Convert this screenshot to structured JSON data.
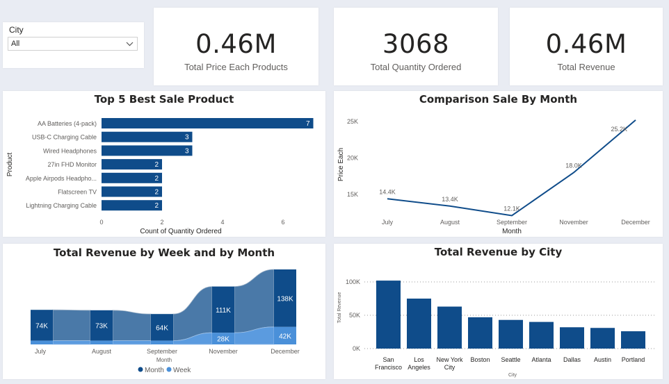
{
  "slicer": {
    "label": "City",
    "value": "All"
  },
  "kpis": [
    {
      "value": "0.46M",
      "label": "Total Price Each Products"
    },
    {
      "value": "3068",
      "label": "Total Quantity Ordered"
    },
    {
      "value": "0.46M",
      "label": "Total Revenue"
    }
  ],
  "titles": {
    "top5": "Top 5 Best Sale Product",
    "month": "Comparison Sale By Month",
    "week": "Total Revenue by Week and by Month",
    "city": "Total Revenue by City"
  },
  "colors": {
    "primary": "#0f4c8a",
    "secondary": "#4a90d9",
    "ribbon": "#4a79a8"
  },
  "chart_data": [
    {
      "type": "bar",
      "orientation": "horizontal",
      "title": "Top 5 Best Sale Product",
      "xlabel": "Count of Quantity Ordered",
      "ylabel": "Product",
      "categories": [
        "AA Batteries (4-pack)",
        "USB-C Charging Cable",
        "Wired Headphones",
        "27in FHD Monitor",
        "Apple Airpods Headpho...",
        "Flatscreen TV",
        "Lightning Charging Cable"
      ],
      "values": [
        7,
        3,
        3,
        2,
        2,
        2,
        2
      ],
      "xticks": [
        "0",
        "2",
        "4",
        "6"
      ],
      "xlim": [
        0,
        7
      ]
    },
    {
      "type": "line",
      "title": "Comparison Sale By Month",
      "xlabel": "Month",
      "ylabel": "Price Each",
      "categories": [
        "July",
        "August",
        "September",
        "November",
        "December"
      ],
      "values": [
        14400,
        13400,
        12100,
        18000,
        25200
      ],
      "labels": [
        "14.4K",
        "13.4K",
        "12.1K",
        "18.0K",
        "25.2K"
      ],
      "yticks": [
        "15K",
        "20K",
        "25K"
      ],
      "ylim": [
        11500,
        26000
      ]
    },
    {
      "type": "bar",
      "subtype": "ribbon",
      "title": "Total Revenue by Week and by Month",
      "xlabel": "Month",
      "categories": [
        "July",
        "August",
        "September",
        "November",
        "December"
      ],
      "series": [
        {
          "name": "Month",
          "values": [
            74000,
            73000,
            64000,
            111000,
            138000
          ],
          "labels": [
            "74K",
            "73K",
            "64K",
            "111K",
            "138K"
          ]
        },
        {
          "name": "Week",
          "values": [
            9000,
            9000,
            9000,
            28000,
            42000
          ],
          "labels": [
            "",
            "",
            "",
            "28K",
            "42K"
          ]
        }
      ],
      "legend": "bottom"
    },
    {
      "type": "bar",
      "title": "Total Revenue by City",
      "xlabel": "City",
      "ylabel": "Total Revenue",
      "categories": [
        "San Francisco",
        "Los Angeles",
        "New York City",
        "Boston",
        "Seattle",
        "Atlanta",
        "Dallas",
        "Austin",
        "Portland"
      ],
      "values": [
        102000,
        75000,
        63000,
        47000,
        43000,
        40000,
        32000,
        31000,
        26000
      ],
      "yticks": [
        "0K",
        "50K",
        "100K"
      ],
      "ylim": [
        0,
        110000
      ],
      "grid": true
    }
  ]
}
